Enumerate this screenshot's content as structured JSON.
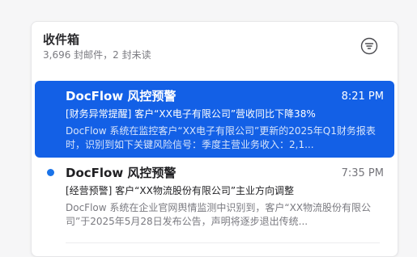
{
  "inbox": {
    "title": "收件箱",
    "summary": "3,696 封邮件，2 封未读"
  },
  "icons": {
    "filter": "filter-lines-icon",
    "unread": "unread-dot-icon"
  },
  "colors": {
    "selected_bg": "#1360e6",
    "unread_dot": "#1a73e8"
  },
  "messages": [
    {
      "sender": "DocFlow 风控预警",
      "time": "8:21 PM",
      "subject": "[财务异常提醒] 客户“XX电子有限公司”营收同比下降38%",
      "preview": "DocFlow 系统在监控客户“XX电子有限公司”更新的2025年Q1财务报表时，识别到如下关键风险信号：季度主营业务收入：2,1...",
      "selected": true,
      "unread": false
    },
    {
      "sender": "DocFlow 风控预警",
      "time": "7:35 PM",
      "subject": "[经营预警] 客户“XX物流股份有限公司”主业方向调整",
      "preview": "DocFlow 系统在企业官网舆情监测中识别到，客户“XX物流股份有限公司”于2025年5月28日发布公告，声明将逐步退出传统...",
      "selected": false,
      "unread": true
    }
  ]
}
